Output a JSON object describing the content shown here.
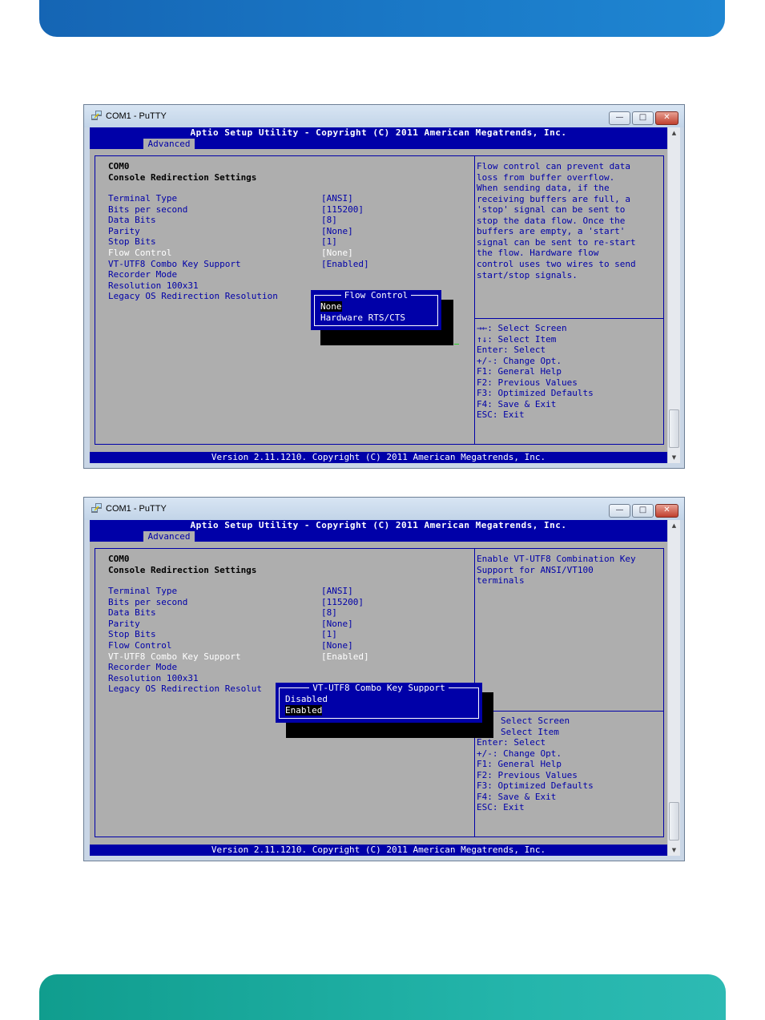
{
  "windows": [
    {
      "title": "COM1 - PuTTY",
      "bios": {
        "header": "Aptio Setup Utility - Copyright (C) 2011 American Megatrends, Inc.",
        "tab": "Advanced",
        "section_lines": [
          "COM0",
          "Console Redirection Settings"
        ],
        "settings": [
          {
            "label": "Terminal Type",
            "value": "[ANSI]"
          },
          {
            "label": "Bits per second",
            "value": "[115200]"
          },
          {
            "label": "Data Bits",
            "value": "[8]"
          },
          {
            "label": "Parity",
            "value": "[None]"
          },
          {
            "label": "Stop Bits",
            "value": "[1]"
          },
          {
            "label": "Flow Control",
            "value": "[None]"
          },
          {
            "label": "VT-UTF8 Combo Key Support",
            "value": "[Enabled]"
          },
          {
            "label": "Recorder Mode",
            "value": ""
          },
          {
            "label": "Resolution 100x31",
            "value": ""
          },
          {
            "label": "Legacy OS Redirection Resolution",
            "value": ""
          }
        ],
        "selected_index": 5,
        "help_lines": [
          "Flow control can prevent data",
          "loss from buffer overflow.",
          "When sending data, if the",
          "receiving buffers are full, a",
          "'stop' signal can be sent to",
          "stop the data flow. Once the",
          "buffers are empty, a 'start'",
          "signal can be sent to re-start",
          "the flow. Hardware flow",
          "control uses two wires to send",
          "start/stop signals."
        ],
        "key_help": [
          "→←: Select Screen",
          "↑↓: Select Item",
          "Enter: Select",
          "+/-: Change Opt.",
          "F1: General Help",
          "F2: Previous Values",
          "F3: Optimized Defaults",
          "F4: Save & Exit",
          "ESC: Exit"
        ],
        "popup": {
          "title": "Flow Control",
          "options": [
            "None",
            "Hardware RTS/CTS"
          ],
          "selected": 0
        },
        "footer": "Version 2.11.1210. Copyright (C) 2011 American Megatrends, Inc."
      }
    },
    {
      "title": "COM1 - PuTTY",
      "bios": {
        "header": "Aptio Setup Utility - Copyright (C) 2011 American Megatrends, Inc.",
        "tab": "Advanced",
        "section_lines": [
          "COM0",
          "Console Redirection Settings"
        ],
        "settings": [
          {
            "label": "Terminal Type",
            "value": "[ANSI]"
          },
          {
            "label": "Bits per second",
            "value": "[115200]"
          },
          {
            "label": "Data Bits",
            "value": "[8]"
          },
          {
            "label": "Parity",
            "value": "[None]"
          },
          {
            "label": "Stop Bits",
            "value": "[1]"
          },
          {
            "label": "Flow Control",
            "value": "[None]"
          },
          {
            "label": "VT-UTF8 Combo Key Support",
            "value": "[Enabled]"
          },
          {
            "label": "Recorder Mode",
            "value": ""
          },
          {
            "label": "Resolution 100x31",
            "value": ""
          },
          {
            "label": "Legacy OS Redirection Resolut",
            "value": ""
          }
        ],
        "selected_index": 6,
        "help_lines": [
          "Enable VT-UTF8 Combination Key",
          "Support for ANSI/VT100",
          "terminals"
        ],
        "key_help": [
          "Select Screen",
          "Select Item",
          "Enter: Select",
          "+/-: Change Opt.",
          "F1: General Help",
          "F2: Previous Values",
          "F3: Optimized Defaults",
          "F4: Save & Exit",
          "ESC: Exit"
        ],
        "popup": {
          "title": "VT-UTF8 Combo Key Support",
          "options": [
            "Disabled",
            "Enabled"
          ],
          "selected": 1
        },
        "footer": "Version 2.11.1210. Copyright (C) 2011 American Megatrends, Inc."
      }
    }
  ],
  "icons": {
    "minimize": "minimize-icon",
    "maximize": "maximize-icon",
    "close": "close-icon"
  }
}
